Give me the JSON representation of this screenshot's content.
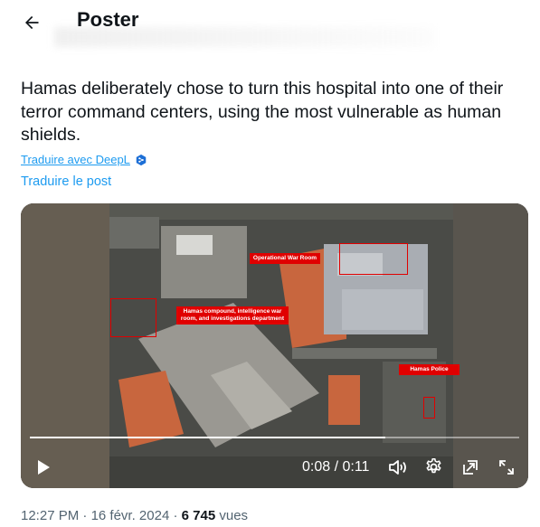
{
  "header": {
    "title": "Poster",
    "back_icon": "arrow-left-icon"
  },
  "tweet": {
    "text": "Hamas deliberately chose to turn this hospital into one of their terror command centers, using the most vulnerable as human shields.",
    "deepl_label": "Traduire avec DeepL",
    "translate_label": "Traduire le post"
  },
  "media": {
    "labels": {
      "war_room": "Operational War Room",
      "compound": "Hamas compound, intelligence war room, and investigations department",
      "police": "Hamas Police"
    },
    "progress": 0.727,
    "time_display": "0:08 / 0:11",
    "controls": [
      "play-icon",
      "volume-icon",
      "settings-icon",
      "picture-in-picture-icon",
      "fullscreen-icon"
    ]
  },
  "meta": {
    "time": "12:27 PM",
    "separator": " · ",
    "date": "16 févr. 2024",
    "separator2": " · ",
    "views_count": "6 745",
    "views_label": " vues"
  },
  "colors": {
    "accent": "#1d9bf0",
    "annotation_red": "#e00000"
  }
}
